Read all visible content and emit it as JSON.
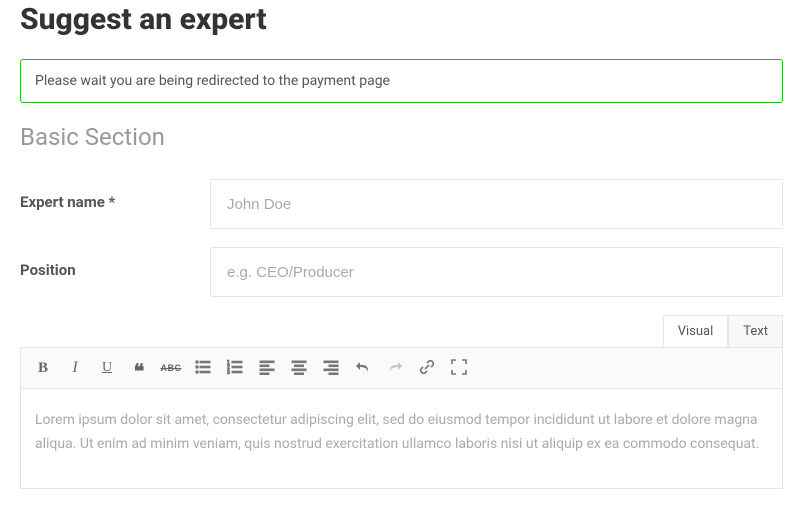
{
  "page": {
    "title": "Suggest an expert"
  },
  "alert": {
    "message": "Please wait you are being redirected to the payment page"
  },
  "section": {
    "title": "Basic Section"
  },
  "fields": {
    "expert_name": {
      "label": "Expert name *",
      "placeholder": "John Doe",
      "value": ""
    },
    "position": {
      "label": "Position",
      "placeholder": "e.g. CEO/Producer",
      "value": ""
    }
  },
  "editor": {
    "tabs": {
      "visual": "Visual",
      "text": "Text",
      "active": "visual"
    },
    "content_placeholder": "Lorem ipsum dolor sit amet, consectetur adipiscing elit, sed do eiusmod tempor incididunt ut labore et dolore magna aliqua. Ut enim ad minim veniam, quis nostrud exercitation ullamco laboris nisi ut aliquip ex ea commodo consequat."
  }
}
